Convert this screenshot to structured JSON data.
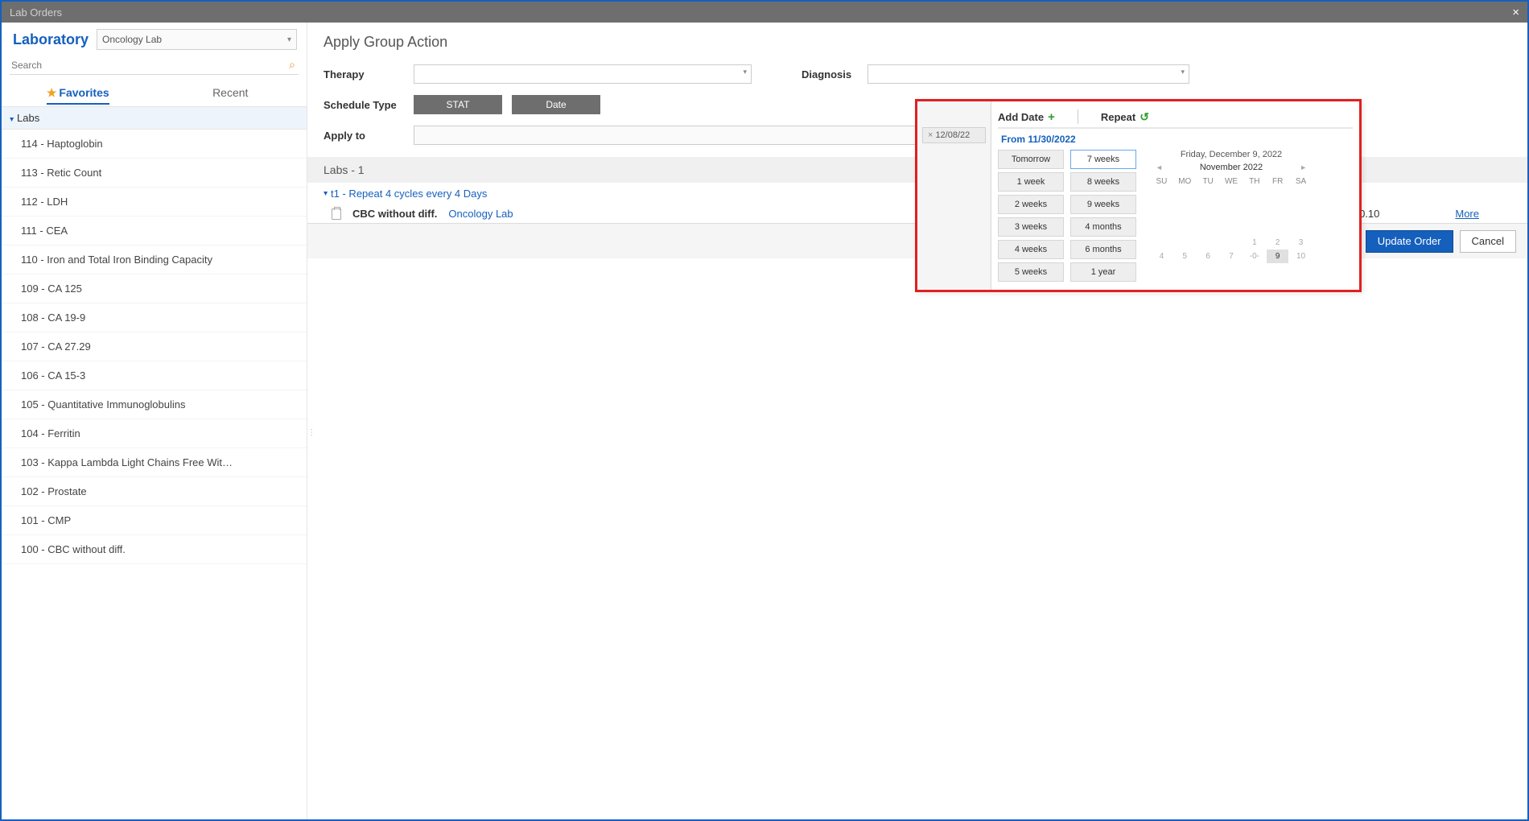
{
  "window": {
    "title": "Lab Orders"
  },
  "sidebar": {
    "title": "Laboratory",
    "selected_lab": "Oncology Lab",
    "search_placeholder": "Search",
    "tabs": {
      "favorites": "Favorites",
      "recent": "Recent"
    },
    "group": "Labs",
    "items": [
      "114 - Haptoglobin",
      "113 - Retic Count",
      "112 - LDH",
      "111 - CEA",
      "110 - Iron and Total Iron Binding Capacity",
      "109 - CA 125",
      "108 - CA 19-9",
      "107 - CA 27.29",
      "106 - CA 15-3",
      "105 - Quantitative Immunoglobulins",
      "104 - Ferritin",
      "103 - Kappa Lambda Light Chains Free Wit…",
      "102 - Prostate",
      "101 - CMP",
      "100 - CBC without diff."
    ]
  },
  "main": {
    "section_title": "Apply Group Action",
    "therapy_label": "Therapy",
    "diagnosis_label": "Diagnosis",
    "schedule_label": "Schedule Type",
    "stat_btn": "STAT",
    "date_btn": "Date",
    "applyto_label": "Apply to",
    "labs_header": "Labs - 1",
    "cycle_text": "t1 - Repeat 4 cycles every 4 Days",
    "order": {
      "name": "CBC without diff.",
      "location": "Oncology Lab",
      "code": "C90.10",
      "more": "More"
    }
  },
  "popup": {
    "date_chip": "12/08/22",
    "tab_add": "Add Date",
    "tab_repeat": "Repeat",
    "from_text": "From 11/30/2022",
    "quick_col1": [
      "Tomorrow",
      "1 week",
      "2 weeks",
      "3 weeks",
      "4 weeks",
      "5 weeks"
    ],
    "quick_col2": [
      "7 weeks",
      "8 weeks",
      "9 weeks",
      "4 months",
      "6 months",
      "1 year"
    ],
    "quick_selected": "7 weeks",
    "cal": {
      "full_day": "Friday, December 9, 2022",
      "month": "November 2022",
      "wd": [
        "SU",
        "MO",
        "TU",
        "WE",
        "TH",
        "FR",
        "SA"
      ],
      "row1": [
        "",
        "",
        "",
        "",
        "1",
        "2",
        "3"
      ],
      "row2": [
        "4",
        "5",
        "6",
        "7",
        "-0-",
        "9",
        "10"
      ],
      "selected": "9"
    }
  },
  "footer": {
    "update": "Update Order",
    "cancel": "Cancel"
  }
}
